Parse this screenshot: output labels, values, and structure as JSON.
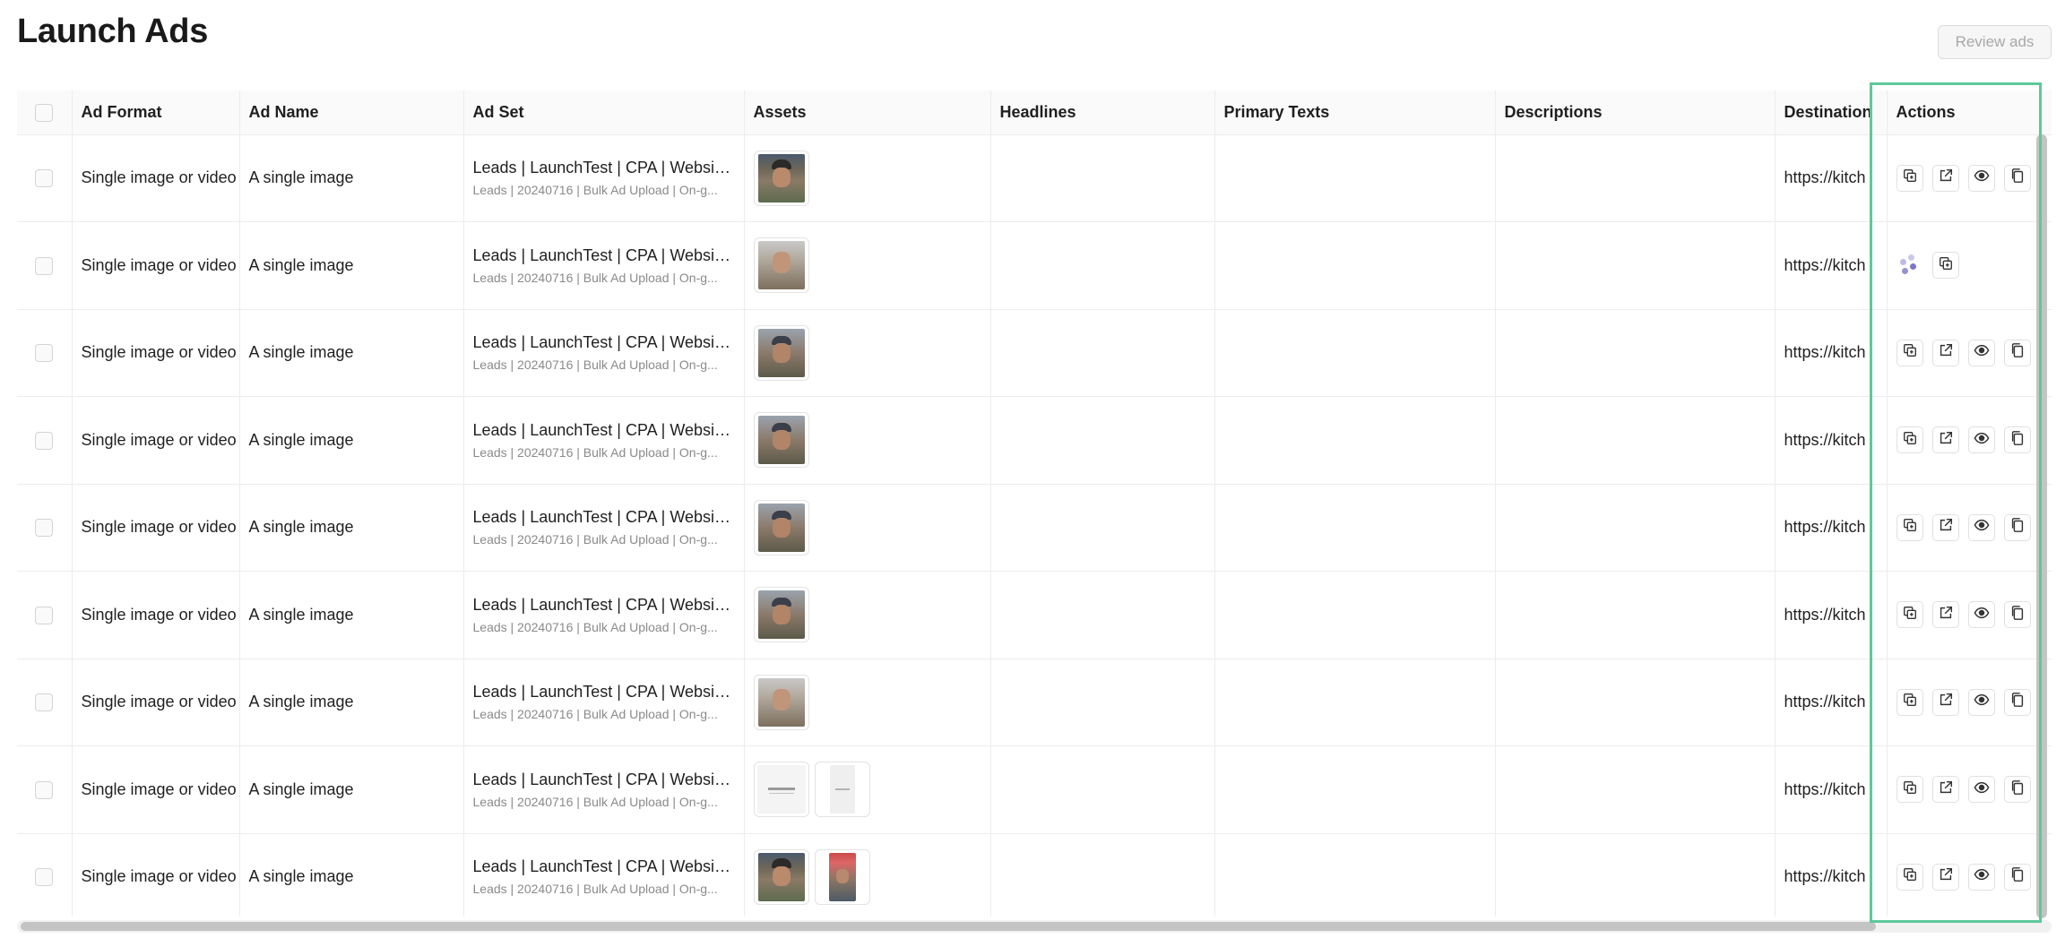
{
  "page": {
    "title": "Launch Ads",
    "review_button": "Review ads"
  },
  "table": {
    "columns": [
      "Ad Format",
      "Ad Name",
      "Ad Set",
      "Assets",
      "Headlines",
      "Primary Texts",
      "Descriptions",
      "Destination",
      "Actions"
    ],
    "rows": [
      {
        "ad_format": "Single image or video",
        "ad_name": "A single image",
        "ad_set_main": "Leads | LaunchTest | CPA | Website ...",
        "ad_set_sub": "Leads | 20240716 | Bulk Ad Upload | On-g...",
        "destination": "https://kitch",
        "assets": [
          "photo"
        ],
        "loading": false
      },
      {
        "ad_format": "Single image or video",
        "ad_name": "A single image",
        "ad_set_main": "Leads | LaunchTest | CPA | Website ...",
        "ad_set_sub": "Leads | 20240716 | Bulk Ad Upload | On-g...",
        "destination": "https://kitch",
        "assets": [
          "photo2"
        ],
        "loading": true
      },
      {
        "ad_format": "Single image or video",
        "ad_name": "A single image",
        "ad_set_main": "Leads | LaunchTest | CPA | Website ...",
        "ad_set_sub": "Leads | 20240716 | Bulk Ad Upload | On-g...",
        "destination": "https://kitch",
        "assets": [
          "photo3"
        ],
        "loading": false
      },
      {
        "ad_format": "Single image or video",
        "ad_name": "A single image",
        "ad_set_main": "Leads | LaunchTest | CPA | Website ...",
        "ad_set_sub": "Leads | 20240716 | Bulk Ad Upload | On-g...",
        "destination": "https://kitch",
        "assets": [
          "photo3"
        ],
        "loading": false
      },
      {
        "ad_format": "Single image or video",
        "ad_name": "A single image",
        "ad_set_main": "Leads | LaunchTest | CPA | Website ...",
        "ad_set_sub": "Leads | 20240716 | Bulk Ad Upload | On-g...",
        "destination": "https://kitch",
        "assets": [
          "photo3"
        ],
        "loading": false
      },
      {
        "ad_format": "Single image or video",
        "ad_name": "A single image",
        "ad_set_main": "Leads | LaunchTest | CPA | Website ...",
        "ad_set_sub": "Leads | 20240716 | Bulk Ad Upload | On-g...",
        "destination": "https://kitch",
        "assets": [
          "photo3"
        ],
        "loading": false
      },
      {
        "ad_format": "Single image or video",
        "ad_name": "A single image",
        "ad_set_main": "Leads | LaunchTest | CPA | Website ...",
        "ad_set_sub": "Leads | 20240716 | Bulk Ad Upload | On-g...",
        "destination": "https://kitch",
        "assets": [
          "photo2"
        ],
        "loading": false
      },
      {
        "ad_format": "Single image or video",
        "ad_name": "A single image",
        "ad_set_main": "Leads | LaunchTest | CPA | Website ...",
        "ad_set_sub": "Leads | 20240716 | Bulk Ad Upload | On-g...",
        "destination": "https://kitch",
        "assets": [
          "doc",
          "tall"
        ],
        "loading": false
      },
      {
        "ad_format": "Single image or video",
        "ad_name": "A single image",
        "ad_set_main": "Leads | LaunchTest | CPA | Website ...",
        "ad_set_sub": "Leads | 20240716 | Bulk Ad Upload | On-g...",
        "destination": "https://kitch",
        "assets": [
          "photo",
          "red"
        ],
        "loading": false
      }
    ]
  },
  "icons": {
    "duplicate": "duplicate-icon",
    "edit": "external-edit-icon",
    "preview": "eye-icon",
    "copy": "clipboard-icon"
  },
  "colors": {
    "highlight": "#5ec89a",
    "spinner": "#7b76c9"
  }
}
